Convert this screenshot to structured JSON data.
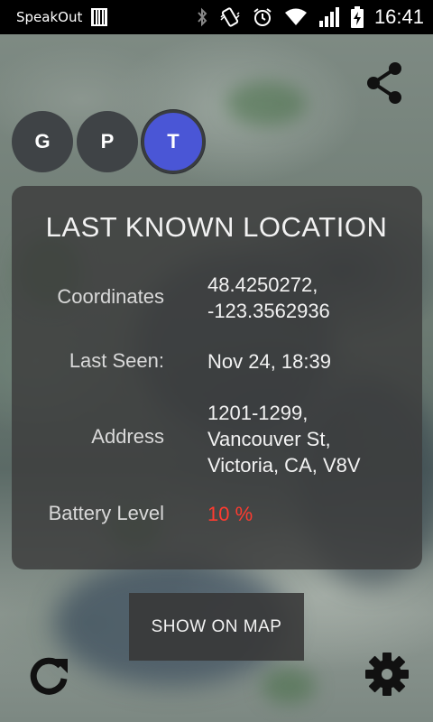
{
  "status_bar": {
    "app_name": "SpeakOut",
    "time": "16:41",
    "icons": [
      "barcode-icon",
      "bluetooth-icon",
      "vibrate-icon",
      "alarm-icon",
      "wifi-icon",
      "signal-icon",
      "battery-charging-icon"
    ]
  },
  "toolbar": {
    "share_icon": "share-icon"
  },
  "modes": [
    {
      "label": "G",
      "active": false
    },
    {
      "label": "P",
      "active": false
    },
    {
      "label": "T",
      "active": true
    }
  ],
  "card": {
    "title": "LAST KNOWN LOCATION",
    "coordinates_label": "Coordinates",
    "coordinates_lines": [
      "48.4250272,",
      "-123.3562936"
    ],
    "last_seen_label": "Last Seen:",
    "last_seen_value": "Nov 24, 18:39",
    "address_label": "Address",
    "address_lines": [
      "1201-1299,",
      "Vancouver St,",
      "Victoria, CA, V8V"
    ],
    "battery_label": "Battery Level",
    "battery_value": "10 %"
  },
  "actions": {
    "show_on_map_label": "SHOW ON MAP",
    "refresh_icon": "refresh-icon",
    "settings_icon": "gear-icon"
  },
  "colors": {
    "accent": "#4a56d6",
    "battery_low": "#ff3b30",
    "card_bg": "#3c3c3c"
  }
}
